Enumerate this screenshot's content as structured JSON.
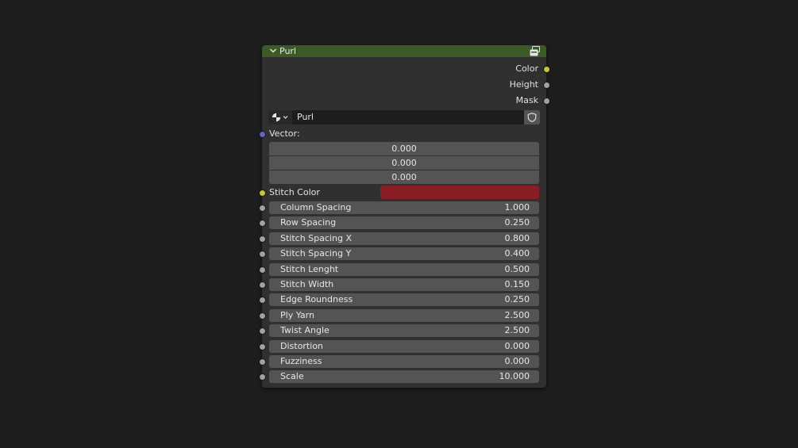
{
  "node": {
    "title": "Purl",
    "header_color": "#3b5a26",
    "outputs": [
      {
        "label": "Color",
        "socket_color": "#c7c729"
      },
      {
        "label": "Height",
        "socket_color": "#a1a1a1"
      },
      {
        "label": "Mask",
        "socket_color": "#a1a1a1"
      }
    ],
    "datablock": {
      "name": "Purl"
    },
    "vector": {
      "label": "Vector:",
      "values": [
        "0.000",
        "0.000",
        "0.000"
      ]
    },
    "stitch_color": {
      "label": "Stitch Color",
      "value": "#8b1d24"
    },
    "sliders": [
      {
        "label": "Column Spacing",
        "value": "1.000"
      },
      {
        "label": "Row Spacing",
        "value": "0.250"
      },
      {
        "label": "Stitch Spacing X",
        "value": "0.800"
      },
      {
        "label": "Stitch Spacing Y",
        "value": "0.400"
      },
      {
        "label": "Stitch Lenght",
        "value": "0.500"
      },
      {
        "label": "Stitch Width",
        "value": "0.150"
      },
      {
        "label": "Edge Roundness",
        "value": "0.250"
      },
      {
        "label": "Ply Yarn",
        "value": "2.500"
      },
      {
        "label": "Twist Angle",
        "value": "2.500"
      },
      {
        "label": "Distortion",
        "value": "0.000"
      },
      {
        "label": "Fuzziness",
        "value": "0.000"
      },
      {
        "label": "Scale",
        "value": "10.000"
      }
    ]
  }
}
